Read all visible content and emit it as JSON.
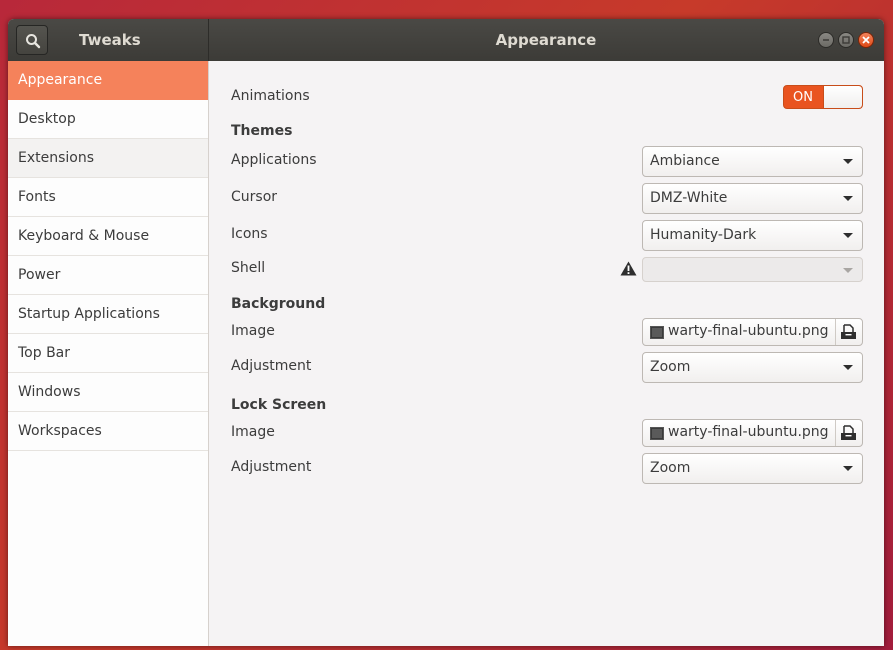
{
  "titlebar": {
    "app_title": "Tweaks",
    "page_title": "Appearance"
  },
  "sidebar": {
    "items": [
      {
        "label": "Appearance"
      },
      {
        "label": "Desktop"
      },
      {
        "label": "Extensions"
      },
      {
        "label": "Fonts"
      },
      {
        "label": "Keyboard & Mouse"
      },
      {
        "label": "Power"
      },
      {
        "label": "Startup Applications"
      },
      {
        "label": "Top Bar"
      },
      {
        "label": "Windows"
      },
      {
        "label": "Workspaces"
      }
    ],
    "selected": "Appearance"
  },
  "main": {
    "animations": {
      "label": "Animations",
      "toggle_text": "ON",
      "value": true
    },
    "themes": {
      "heading": "Themes",
      "applications": {
        "label": "Applications",
        "value": "Ambiance"
      },
      "cursor": {
        "label": "Cursor",
        "value": "DMZ-White"
      },
      "icons": {
        "label": "Icons",
        "value": "Humanity-Dark"
      },
      "shell": {
        "label": "Shell",
        "value": ""
      }
    },
    "background": {
      "heading": "Background",
      "image": {
        "label": "Image",
        "value": "warty-final-ubuntu.png"
      },
      "adjustment": {
        "label": "Adjustment",
        "value": "Zoom"
      }
    },
    "lock_screen": {
      "heading": "Lock Screen",
      "image": {
        "label": "Image",
        "value": "warty-final-ubuntu.png"
      },
      "adjustment": {
        "label": "Adjustment",
        "value": "Zoom"
      }
    }
  },
  "colors": {
    "accent": "#e95420",
    "sidebar_selected": "#f5825b",
    "titlebar": "#3c3b37"
  }
}
